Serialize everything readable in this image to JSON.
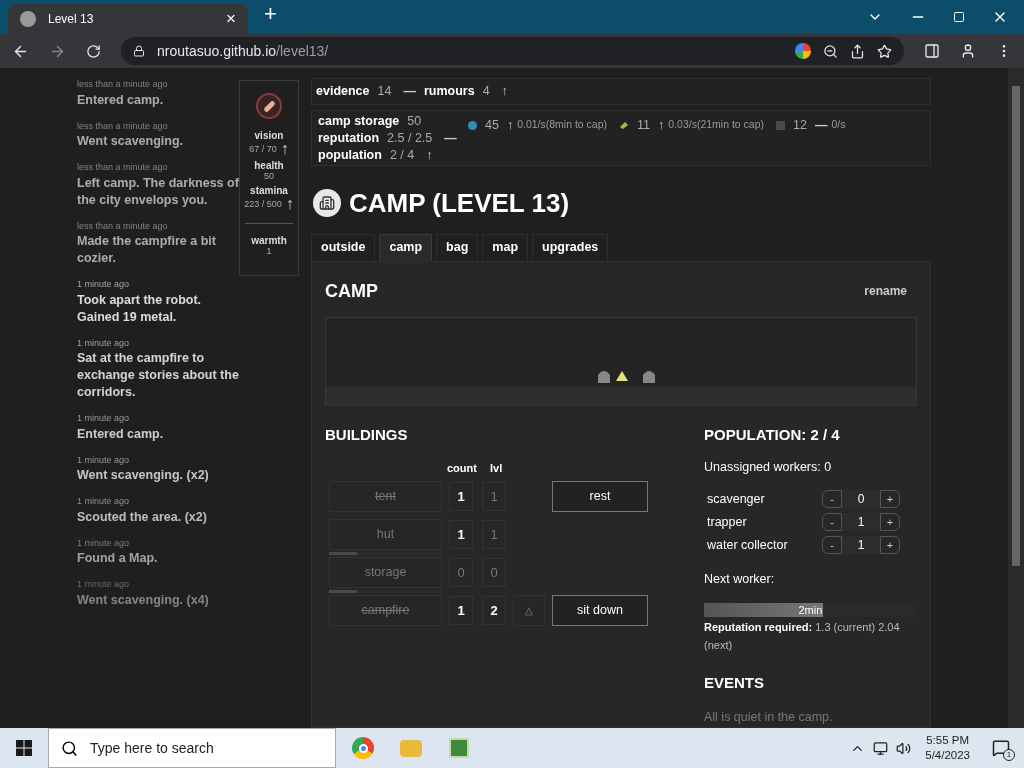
{
  "browser": {
    "tab": {
      "title": "Level 13",
      "close": "×"
    },
    "new_tab": "+",
    "url": {
      "host": "nroutasuo.github.io",
      "path": "/level13/"
    }
  },
  "log": [
    {
      "time": "less than a minute ago",
      "text": "Entered camp."
    },
    {
      "time": "less than a minute ago",
      "text": "Went scavenging."
    },
    {
      "time": "less than a minute ago",
      "text": "Left camp. The darkness of the city envelops you."
    },
    {
      "time": "less than a minute ago",
      "text": "Made the campfire a bit cozier."
    },
    {
      "time": "1 minute ago",
      "text": "Took apart the robot. Gained 19 metal."
    },
    {
      "time": "1 minute ago",
      "text": "Sat at the campfire to exchange stories about the corridors."
    },
    {
      "time": "1 minute ago",
      "text": "Entered camp."
    },
    {
      "time": "1 minute ago",
      "text": "Went scavenging. (x2)"
    },
    {
      "time": "1 minute ago",
      "text": "Scouted the area. (x2)"
    },
    {
      "time": "1 minute ago",
      "text": "Found a Map."
    },
    {
      "time": "1 minute ago",
      "text": "Went scavenging. (x4)"
    }
  ],
  "stats": [
    {
      "label": "vision",
      "value": "67 / 70",
      "trend": "↑"
    },
    {
      "label": "health",
      "value": "50"
    },
    {
      "label": "stamina",
      "value": "223 / 500",
      "trend": "↑"
    }
  ],
  "warmth": {
    "label": "warmth",
    "value": "1"
  },
  "top_bar": [
    {
      "label": "evidence",
      "value": "14",
      "trend": "—"
    },
    {
      "label": "rumours",
      "value": "4",
      "trend": "↑"
    }
  ],
  "camp_stats": [
    {
      "label": "camp storage",
      "value": "50"
    },
    {
      "label": "reputation",
      "value": "2.5 / 2.5",
      "trend": "—"
    },
    {
      "label": "population",
      "value": "2 / 4",
      "trend": "↑"
    }
  ],
  "resources": [
    {
      "kind": "dot",
      "color": "#2a8fb0",
      "value": "45",
      "trend": "↑",
      "rate": "0.01/s",
      "cap": "(8min to cap)"
    },
    {
      "kind": "tool",
      "color": "#b8b04a",
      "value": "11",
      "trend": "↑",
      "rate": "0.03/s",
      "cap": "(21min to cap)"
    },
    {
      "kind": "square",
      "color": "#4a4a4a",
      "value": "12",
      "trend": "—",
      "rate": "0/s"
    }
  ],
  "heading": "CAMP (LEVEL 13)",
  "tabs": [
    {
      "label": "outside",
      "selected": false
    },
    {
      "label": "camp",
      "selected": true
    },
    {
      "label": "bag",
      "selected": false
    },
    {
      "label": "map",
      "selected": false
    },
    {
      "label": "upgrades",
      "selected": false
    }
  ],
  "panel": {
    "title": "CAMP",
    "rename": "rename"
  },
  "buildings": {
    "title": "BUILDINGS",
    "columns": [
      "count",
      "lvl"
    ],
    "rows": [
      {
        "name": "tent",
        "struck": true,
        "count": "1",
        "count_lit": true,
        "lvl": "1",
        "lvl_lit": false,
        "action": "rest"
      },
      {
        "name": "hut",
        "struck": false,
        "level": 0.25,
        "count": "1",
        "count_lit": true,
        "lvl": "1",
        "lvl_lit": false
      },
      {
        "name": "storage",
        "struck": false,
        "level": 0.25,
        "count": "0",
        "count_lit": false,
        "lvl": "0",
        "lvl_lit": false
      },
      {
        "name": "campfire",
        "struck": true,
        "count": "1",
        "count_lit": true,
        "lvl": "2",
        "lvl_lit": true,
        "upgrade": "△",
        "action": "sit down"
      }
    ]
  },
  "population": {
    "title": "POPULATION: 2 / 4",
    "unassigned": "Unassigned workers: 0",
    "workers": [
      {
        "name": "scavenger",
        "value": "0"
      },
      {
        "name": "trapper",
        "value": "1"
      },
      {
        "name": "water collector",
        "value": "1"
      }
    ],
    "minus": "-",
    "plus": "+",
    "next_label": "Next worker:",
    "next_time": "2min",
    "next_bar": {
      "level": 0.56
    },
    "req_label": "Reputation required:",
    "req_text": "1.3 (current) 2.04 (next)"
  },
  "events": {
    "title": "EVENTS",
    "text": "All is quiet in the camp."
  },
  "taskbar": {
    "search": "Type here to search",
    "time": "5:55 PM",
    "date": "5/4/2023",
    "notifications": "1"
  }
}
